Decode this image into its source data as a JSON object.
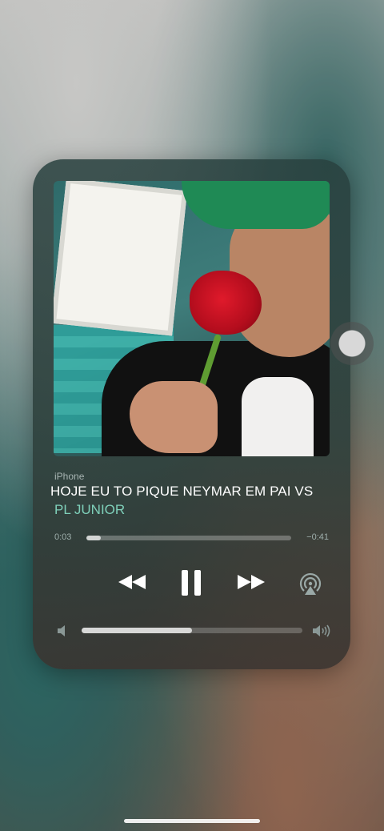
{
  "player": {
    "device": "iPhone",
    "title": "HOJE EU TO PIQUE NEYMAR EM PAI VS",
    "artist": "PL JUNIOR",
    "time_elapsed": "0:03",
    "time_remaining": "−0:41",
    "progress_fraction": 0.07,
    "volume_fraction": 0.5,
    "artwork_icon": "album-artwork",
    "controls": {
      "rewind_icon": "rewind-icon",
      "pause_icon": "pause-icon",
      "forward_icon": "fast-forward-icon",
      "airplay_icon": "airplay-icon"
    }
  },
  "colors": {
    "accent_artist": "#7ecfb9",
    "text_primary": "#ffffff",
    "text_secondary": "#a7b4b2"
  }
}
